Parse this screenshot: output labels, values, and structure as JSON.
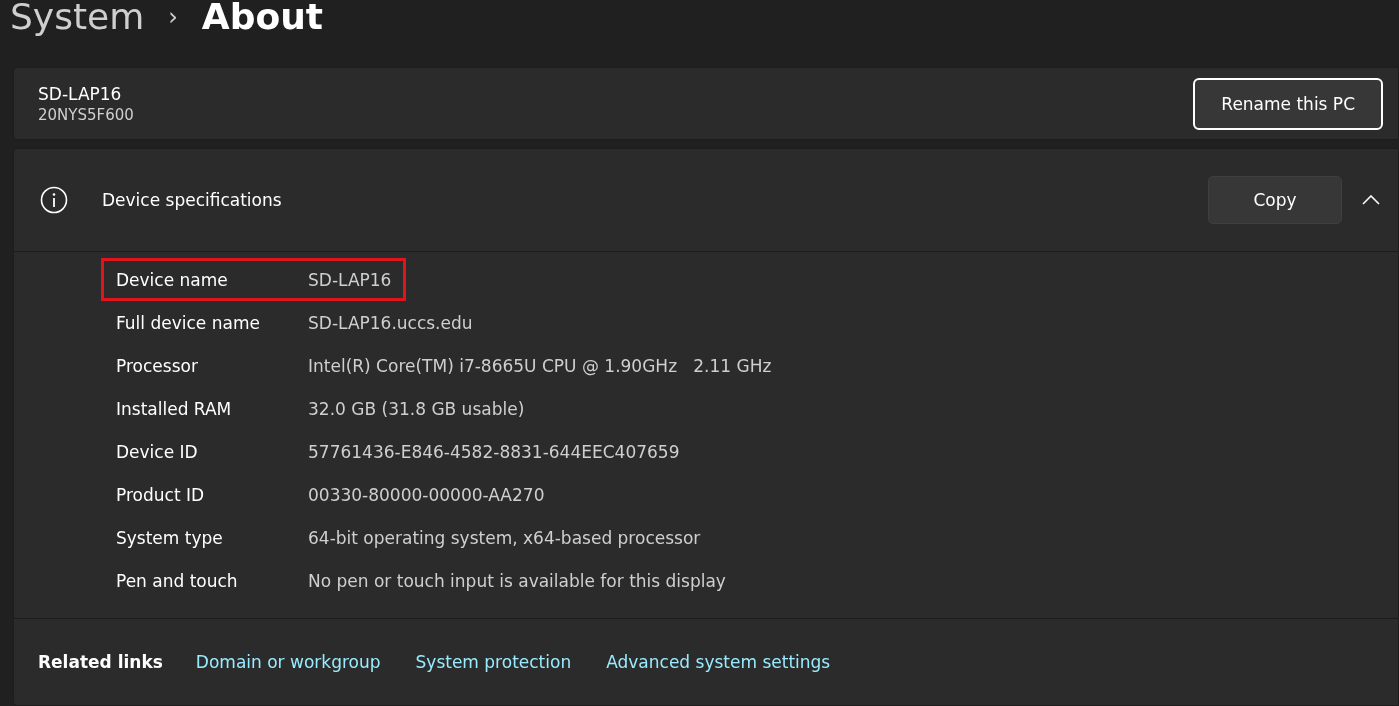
{
  "breadcrumb": {
    "parent": "System",
    "separator": "›",
    "current": "About"
  },
  "device": {
    "name": "SD-LAP16",
    "model": "20NYS5F600",
    "rename_button": "Rename this PC"
  },
  "specs": {
    "title": "Device specifications",
    "copy_button": "Copy",
    "expanded": true,
    "rows": [
      {
        "label": "Device name",
        "value": "SD-LAP16",
        "highlighted": true
      },
      {
        "label": "Full device name",
        "value": "SD-LAP16.uccs.edu",
        "highlighted": false
      },
      {
        "label": "Processor",
        "value": "Intel(R) Core(TM) i7-8665U CPU @ 1.90GHz   2.11 GHz",
        "highlighted": false
      },
      {
        "label": "Installed RAM",
        "value": "32.0 GB (31.8 GB usable)",
        "highlighted": false
      },
      {
        "label": "Device ID",
        "value": "57761436-E846-4582-8831-644EEC407659",
        "highlighted": false
      },
      {
        "label": "Product ID",
        "value": "00330-80000-00000-AA270",
        "highlighted": false
      },
      {
        "label": "System type",
        "value": "64-bit operating system, x64-based processor",
        "highlighted": false
      },
      {
        "label": "Pen and touch",
        "value": "No pen or touch input is available for this display",
        "highlighted": false
      }
    ]
  },
  "related": {
    "title": "Related links",
    "links": [
      "Domain or workgroup",
      "System protection",
      "Advanced system settings"
    ]
  }
}
